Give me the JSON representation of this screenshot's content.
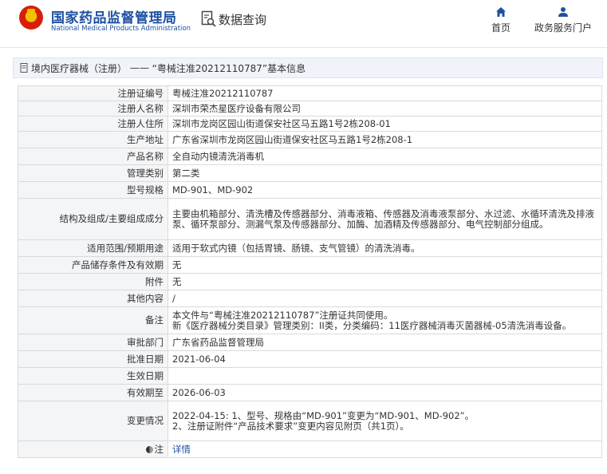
{
  "header": {
    "logo_cn": "国家药品监督管理局",
    "logo_en": "National Medical Products Administration",
    "search_label": "数据查询",
    "nav": [
      {
        "label": "首页",
        "icon": "home-icon"
      },
      {
        "label": "政务服务门户",
        "icon": "user-icon"
      }
    ]
  },
  "breadcrumb": {
    "category": "境内医疗器械（注册）",
    "separator": "——",
    "title": "“粤械注准20212110787”基本信息"
  },
  "rows": [
    {
      "label": "注册证编号",
      "value": "粤械注准20212110787"
    },
    {
      "label": "注册人名称",
      "value": "深圳市荣杰星医疗设备有限公司"
    },
    {
      "label": "注册人住所",
      "value": "深圳市龙岗区园山街道保安社区马五路1号2栋208-01"
    },
    {
      "label": "生产地址",
      "value": "广东省深圳市龙岗区园山街道保安社区马五路1号2栋208-1"
    },
    {
      "label": "产品名称",
      "value": "全自动内镜清洗消毒机"
    },
    {
      "label": "管理类别",
      "value": "第二类"
    },
    {
      "label": "型号规格",
      "value": "MD-901、MD-902"
    },
    {
      "label": "结构及组成/主要组成成分",
      "value": "主要由机箱部分、清洗槽及传感器部分、消毒液箱、传感器及消毒液泵部分、水过滤、水循环清洗及排液泵、循环泵部分、测漏气泵及传感器部分、加酶、加酒精及传感器部分、电气控制部分组成。"
    },
    {
      "label": "适用范围/预期用途",
      "value": "适用于软式内镜（包括胃镜、肠镜、支气管镜）的清洗消毒。"
    },
    {
      "label": "产品储存条件及有效期",
      "value": "无"
    },
    {
      "label": "附件",
      "value": "无"
    },
    {
      "label": "其他内容",
      "value": "/"
    },
    {
      "label": "备注",
      "value": "本文件与“粤械注准20212110787”注册证共同使用。\n新《医疗器械分类目录》管理类别：II类，分类编码：11医疗器械消毒灭菌器械-05清洗消毒设备。"
    },
    {
      "label": "审批部门",
      "value": "广东省药品监督管理局"
    },
    {
      "label": "批准日期",
      "value": "2021-06-04"
    },
    {
      "label": "生效日期",
      "value": ""
    },
    {
      "label": "有效期至",
      "value": "2026-06-03"
    },
    {
      "label": "变更情况",
      "value": "2022-04-15: 1、型号、规格由“MD-901”变更为“MD-901、MD-902”。\n2、注册证附件“产品技术要求”变更内容见附页（共1页）。"
    },
    {
      "label": "注",
      "value": "详情"
    }
  ]
}
